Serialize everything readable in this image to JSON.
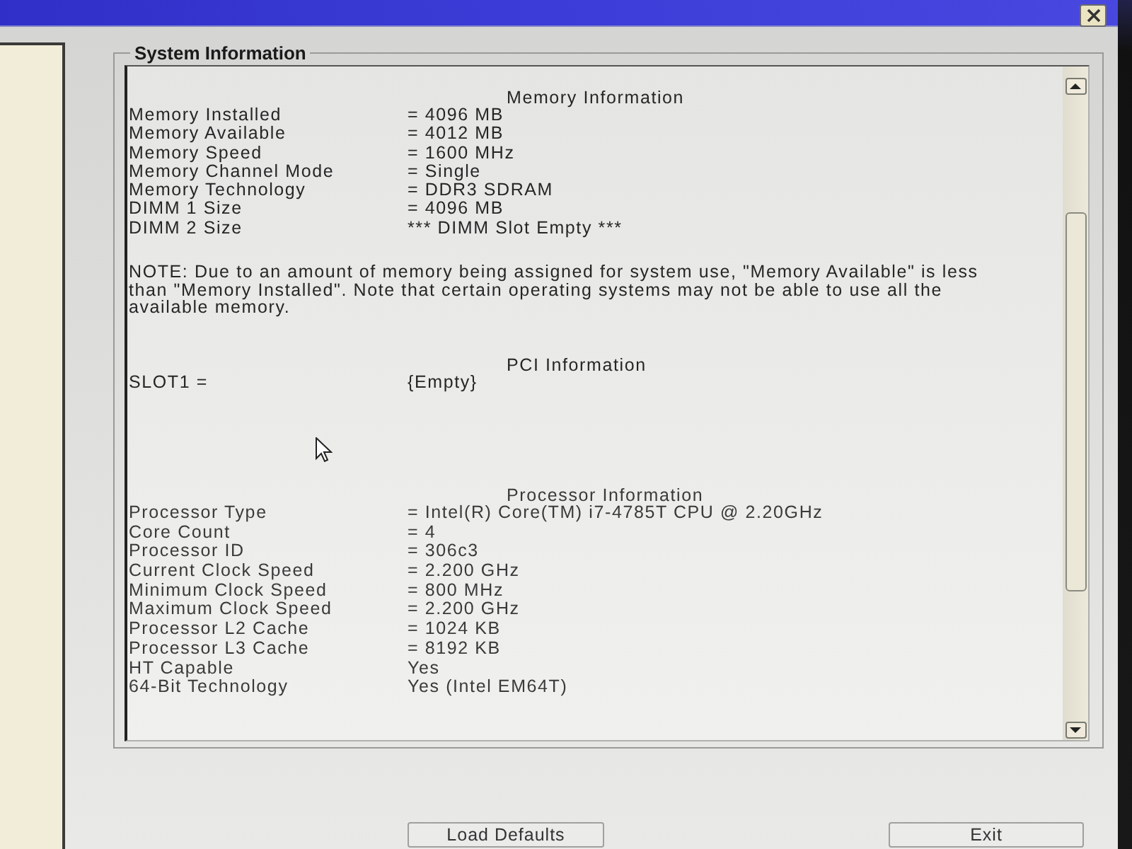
{
  "group": {
    "title": "System Information"
  },
  "sections": [
    {
      "kind": "table",
      "heading": "Memory Information",
      "rows": [
        {
          "label": "Memory Installed",
          "value": "= 4096 MB"
        },
        {
          "label": "Memory Available",
          "value": "= 4012 MB"
        },
        {
          "label": "Memory Speed",
          "value": "= 1600 MHz"
        },
        {
          "label": "Memory Channel Mode",
          "value": "= Single"
        },
        {
          "label": "Memory Technology",
          "value": "= DDR3 SDRAM"
        },
        {
          "label": "DIMM 1 Size",
          "value": "= 4096 MB"
        },
        {
          "label": "DIMM 2 Size",
          "value": "*** DIMM Slot Empty ***"
        }
      ]
    },
    {
      "kind": "note",
      "text": "NOTE: Due to an amount of memory being assigned for system use, \"Memory Available\" is less than \"Memory Installed\". Note that certain operating systems may not be able to use all the available memory."
    },
    {
      "kind": "table",
      "heading": "PCI Information",
      "rows": [
        {
          "label": "SLOT1 =",
          "value": "{Empty}"
        }
      ]
    },
    {
      "kind": "table",
      "heading": "Processor Information",
      "rows": [
        {
          "label": "Processor Type",
          "value": "= Intel(R) Core(TM) i7-4785T CPU @ 2.20GHz"
        },
        {
          "label": "Core Count",
          "value": "= 4"
        },
        {
          "label": "Processor ID",
          "value": "= 306c3"
        },
        {
          "label": "Current Clock Speed",
          "value": "= 2.200 GHz"
        },
        {
          "label": "Minimum Clock Speed",
          "value": "= 800 MHz"
        },
        {
          "label": "Maximum Clock Speed",
          "value": "= 2.200 GHz"
        },
        {
          "label": "Processor L2 Cache",
          "value": "= 1024 KB"
        },
        {
          "label": "Processor L3 Cache",
          "value": "= 8192 KB"
        },
        {
          "label": "HT Capable",
          "value": "Yes"
        },
        {
          "label": "64-Bit Technology",
          "value": "Yes (Intel EM64T)"
        }
      ]
    }
  ],
  "buttons": [
    {
      "label": "Load Defaults"
    },
    {
      "label": "Exit"
    }
  ]
}
